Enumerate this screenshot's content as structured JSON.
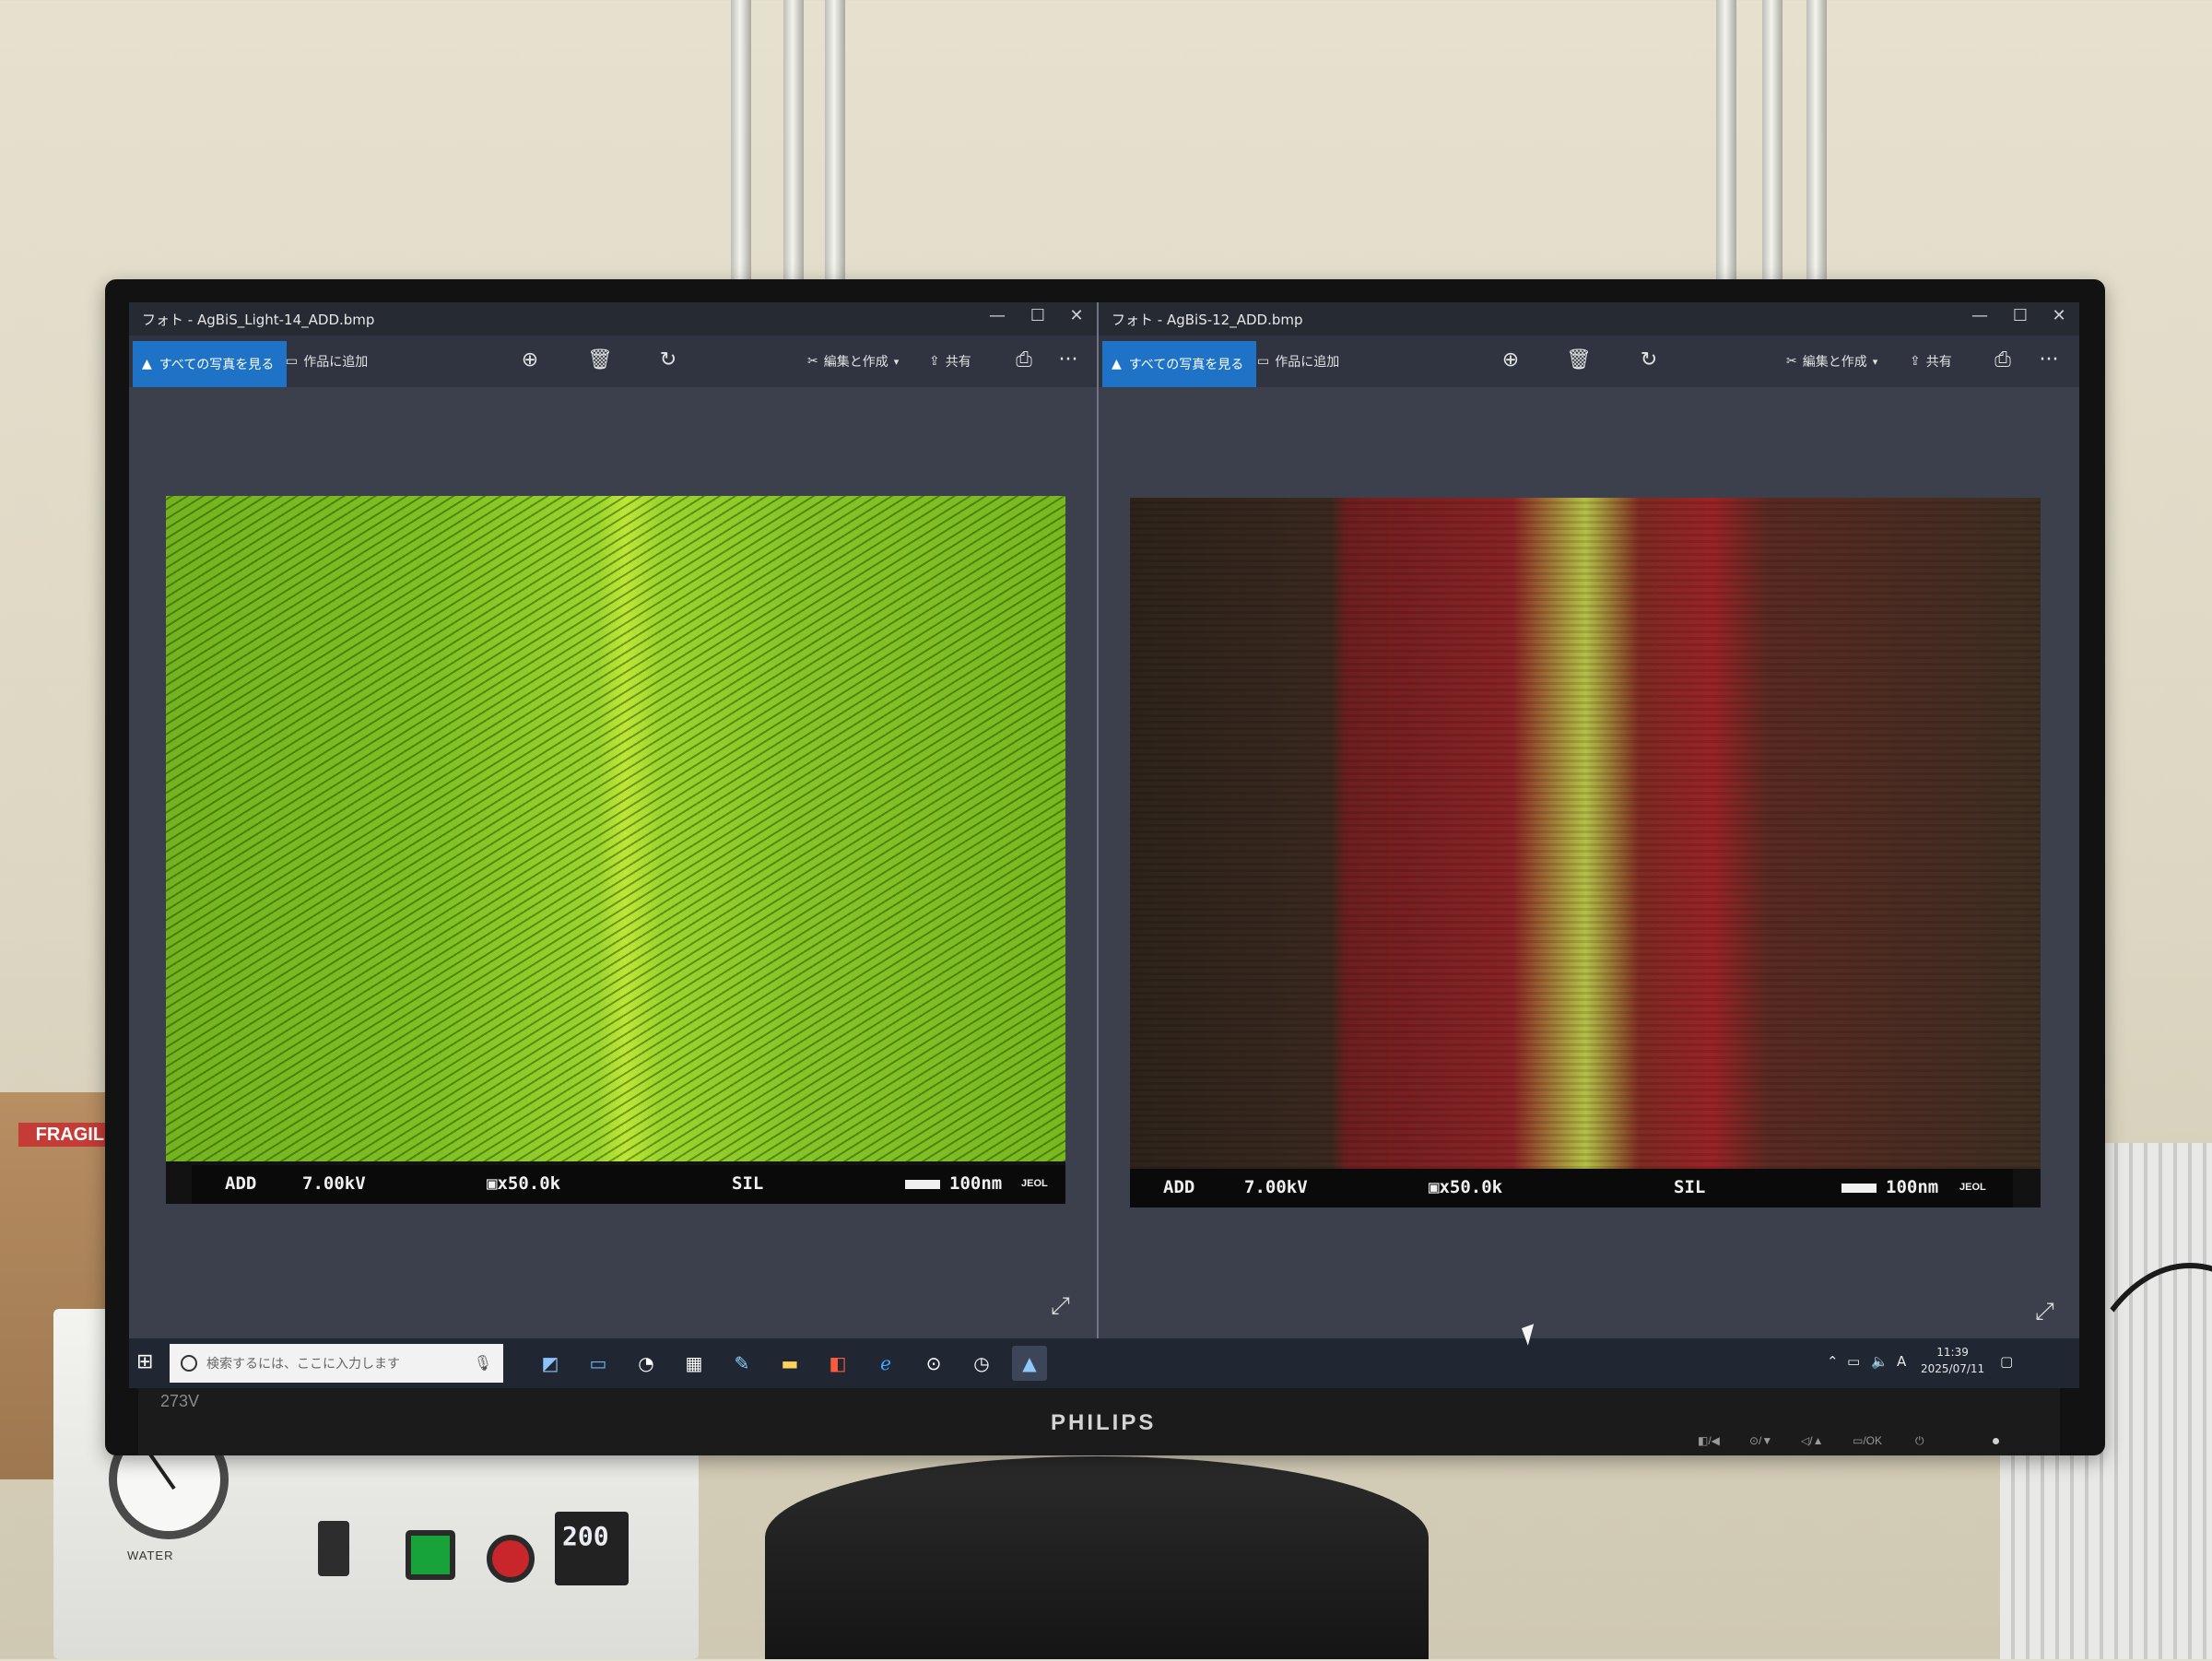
{
  "background": {
    "fragile_label": "FRAGILE",
    "gauge_label": "WATER",
    "temp_display": "200"
  },
  "monitor": {
    "model": "273V",
    "brand": "PHILIPS",
    "osd_buttons": [
      "◧/◀",
      "⊙/▼",
      "◁/▲",
      "▭/OK",
      "⏻"
    ]
  },
  "left_window": {
    "title": "フォト - AgBiS_Light-14_ADD.bmp",
    "controls": [
      "—",
      "☐",
      "✕"
    ],
    "toolbar": {
      "view_all": "すべての写真を見る",
      "add_to_creation": "作品に追加",
      "edit_create": "編集と作成",
      "share": "共有",
      "more": "···"
    },
    "sem": {
      "mode": "ADD",
      "voltage": "7.00kV",
      "magnification": "x50.0k",
      "detector": "SIL",
      "scale": "100nm",
      "vendor": "JEOL"
    }
  },
  "right_window": {
    "title": "フォト - AgBiS-12_ADD.bmp",
    "controls": [
      "—",
      "☐",
      "✕"
    ],
    "toolbar": {
      "view_all": "すべての写真を見る",
      "add_to_creation": "作品に追加",
      "edit_create": "編集と作成",
      "share": "共有",
      "more": "···"
    },
    "sem": {
      "mode": "ADD",
      "voltage": "7.00kV",
      "magnification": "x50.0k",
      "detector": "SIL",
      "scale": "100nm",
      "vendor": "JEOL"
    }
  },
  "taskbar": {
    "search_placeholder": "検索するには、ここに入力します",
    "clock_time": "11:39",
    "clock_date": "2025/07/11",
    "ime": "A"
  },
  "colors": {
    "accent": "#1f73c7",
    "app_bg": "#3b404c",
    "taskbar": "#202733"
  }
}
